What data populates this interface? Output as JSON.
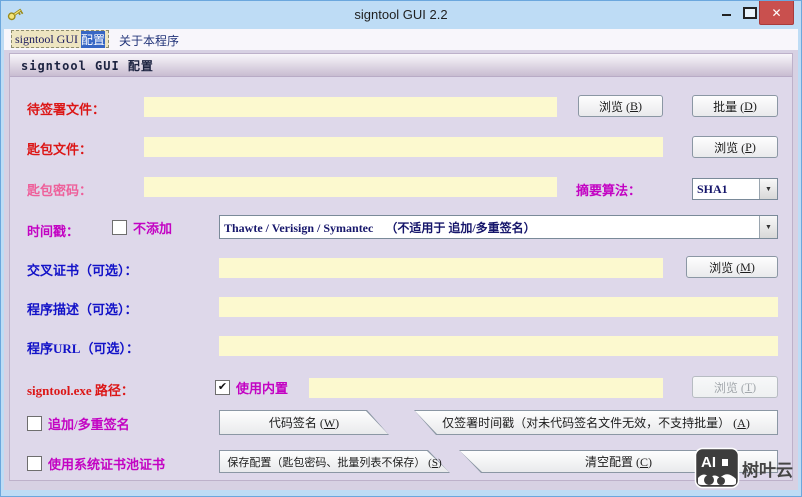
{
  "window": {
    "title": "signtool GUI 2.2"
  },
  "menu": {
    "config_prefix": "signtool GUI ",
    "config_highlight": "配置",
    "about": "关于本程序"
  },
  "group_title": "signtool GUI 配置",
  "form": {
    "sign_file": {
      "label": "待签署文件：",
      "value": ""
    },
    "key_file": {
      "label": "匙包文件：",
      "value": ""
    },
    "key_password": {
      "label": "匙包密码：",
      "value": ""
    },
    "digest": {
      "label": "摘要算法：",
      "selected": "SHA1"
    },
    "timestamp": {
      "label": "时间戳：",
      "no_add_label": "不添加",
      "no_add_checked": false,
      "selected": "Thawte / Verisign / Symantec    （不适用于 追加/多重签名）"
    },
    "cross_cert": {
      "label": "交叉证书（可选）：",
      "value": ""
    },
    "description": {
      "label": "程序描述（可选）：",
      "value": ""
    },
    "program_url": {
      "label": "程序URL（可选）：",
      "value": ""
    },
    "signtool_path": {
      "label": "signtool.exe 路径：",
      "builtin_label": "使用内置",
      "builtin_checked": true,
      "value": ""
    },
    "append_multi": {
      "label": "追加/多重签名",
      "checked": false
    },
    "system_store": {
      "label": "使用系统证书池证书",
      "checked": false
    }
  },
  "buttons": {
    "browse_b": {
      "pre": "浏览 (",
      "key": "B",
      "post": ")"
    },
    "batch_d": {
      "pre": "批量 (",
      "key": "D",
      "post": ")"
    },
    "browse_p": {
      "pre": "浏览 (",
      "key": "P",
      "post": ")"
    },
    "browse_m": {
      "pre": "浏览 (",
      "key": "M",
      "post": ")"
    },
    "browse_t": {
      "pre": "浏览 (",
      "key": "T",
      "post": ")",
      "disabled": true
    },
    "code_sign": {
      "pre": "代码签名 (",
      "key": "W",
      "post": ")"
    },
    "timestamp_only": {
      "pre": "仅签署时间戳（对未代码签名文件无效，不支持批量） (",
      "key": "A",
      "post": ")"
    },
    "save_config": {
      "pre": "保存配置（匙包密码、批量列表不保存） (",
      "key": "S",
      "post": ")"
    },
    "clear_config": {
      "pre": "清空配置 (",
      "key": "C",
      "post": ")"
    }
  },
  "icons": {
    "checkmark": "✔",
    "dropdown_arrow": "▼",
    "close": "✕"
  },
  "watermark": {
    "logo_text": "AI",
    "text": "树叶云"
  },
  "colors": {
    "label_red": "#dc1616",
    "label_pink": "#ee5f9a",
    "label_magenta": "#c303c3",
    "label_blue": "#1212c8",
    "field_yellow": "#fcf9cf",
    "titlebar_blue": "#bedcf5",
    "close_red": "#c9504e"
  }
}
